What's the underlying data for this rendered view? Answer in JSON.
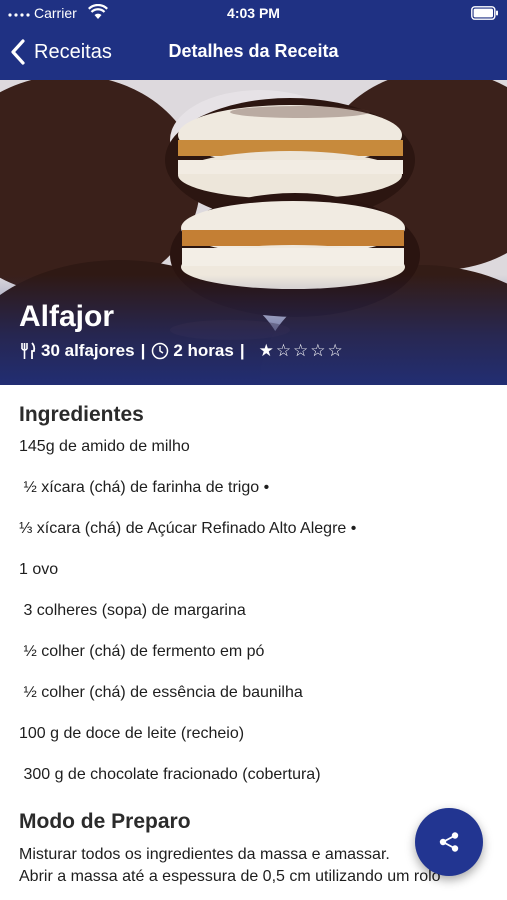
{
  "status": {
    "carrier": "Carrier",
    "time": "4:03 PM"
  },
  "nav": {
    "back_label": "Receitas",
    "title": "Detalhes da Receita"
  },
  "recipe": {
    "name": "Alfajor",
    "yield": "30 alfajores",
    "time": "2 horas",
    "separator": "|",
    "stars": "★☆☆☆☆",
    "rating": 1,
    "rating_max": 5
  },
  "ingredients": {
    "title": "Ingredientes",
    "items": [
      "145g de amido de milho",
      " ½ xícara (chá) de farinha de trigo •",
      "⅓ xícara (chá) de Açúcar Refinado Alto Alegre •",
      "1 ovo",
      " 3 colheres (sopa) de margarina",
      " ½ colher (chá) de fermento em pó",
      " ½ colher (chá) de essência de baunilha",
      "100 g de doce de leite (recheio)",
      " 300 g de chocolate fracionado (cobertura)"
    ]
  },
  "preparation": {
    "title": "Modo de Preparo",
    "lines": [
      "Misturar todos os ingredientes da massa e amassar.",
      "Abrir a massa até a espessura de 0,5 cm utilizando um rolo"
    ]
  },
  "colors": {
    "primary": "#1f3183",
    "fab": "#223591"
  },
  "icons": {
    "fab": "share-icon",
    "back": "chevron-left-icon",
    "yield": "fork-knife-icon",
    "time": "clock-icon"
  }
}
